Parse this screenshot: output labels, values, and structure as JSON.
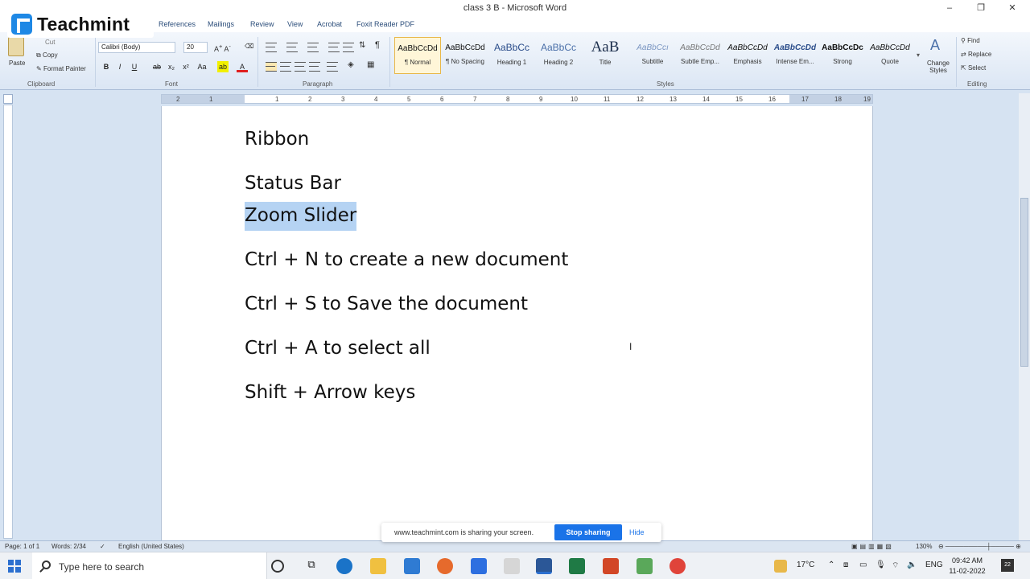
{
  "window": {
    "title": "class 3 B  -  Microsoft Word",
    "minimize": "–",
    "maximize": "❐",
    "close": "✕"
  },
  "brand": {
    "name": "Teachmint",
    "color": "#1e88e5"
  },
  "tabs": [
    "References",
    "Mailings",
    "Review",
    "View",
    "Acrobat",
    "Foxit Reader PDF"
  ],
  "ribbon": {
    "clipboard": {
      "paste": "Paste",
      "cut": "Cut",
      "copy": "Copy",
      "format_painter": "Format Painter",
      "label": "Clipboard"
    },
    "font": {
      "name": "Calibri (Body)",
      "size": "20",
      "bold": "B",
      "italic": "I",
      "underline": "U",
      "label": "Font"
    },
    "paragraph": {
      "label": "Paragraph"
    },
    "styles": {
      "label": "Styles",
      "items": [
        {
          "sample": "AaBbCcDd",
          "name": "¶ Normal",
          "active": true
        },
        {
          "sample": "AaBbCcDd",
          "name": "¶ No Spacing"
        },
        {
          "sample": "AaBbCc",
          "name": "Heading 1"
        },
        {
          "sample": "AaBbCc",
          "name": "Heading 2"
        },
        {
          "sample": "AaB",
          "name": "Title"
        },
        {
          "sample": "AaBbCcı",
          "name": "Subtitle"
        },
        {
          "sample": "AaBbCcDd",
          "name": "Subtle Emp..."
        },
        {
          "sample": "AaBbCcDd",
          "name": "Emphasis"
        },
        {
          "sample": "AaBbCcDd",
          "name": "Intense Em..."
        },
        {
          "sample": "AaBbCcDc",
          "name": "Strong"
        },
        {
          "sample": "AaBbCcDd",
          "name": "Quote"
        }
      ],
      "change_styles": "Change Styles"
    },
    "editing": {
      "find": "Find",
      "replace": "Replace",
      "select": "Select",
      "label": "Editing"
    }
  },
  "ruler": {
    "left_numbers": [
      "2",
      "1"
    ],
    "numbers": [
      "1",
      "2",
      "3",
      "4",
      "5",
      "6",
      "7",
      "8",
      "9",
      "10",
      "11",
      "12",
      "13",
      "14",
      "15",
      "16",
      "17",
      "18",
      "19"
    ]
  },
  "document": {
    "lines": [
      "Ribbon",
      "Status Bar",
      "Zoom Slider",
      "Ctrl + N to create a new document",
      "Ctrl + S to Save the document",
      "Ctrl + A to select all",
      "Shift + Arrow keys"
    ],
    "selected_line": "Zoom Slider"
  },
  "status": {
    "page": "Page: 1 of 1",
    "words": "Words: 2/34",
    "language": "English (United States)",
    "zoom": "130%"
  },
  "share_banner": {
    "text": "www.teachmint.com is sharing your screen.",
    "stop": "Stop sharing",
    "hide": "Hide"
  },
  "taskbar": {
    "search_placeholder": "Type here to search",
    "temperature": "17°C",
    "language": "ENG",
    "time": "09:42 AM",
    "date": "11-02-2022",
    "notifications": "22"
  }
}
